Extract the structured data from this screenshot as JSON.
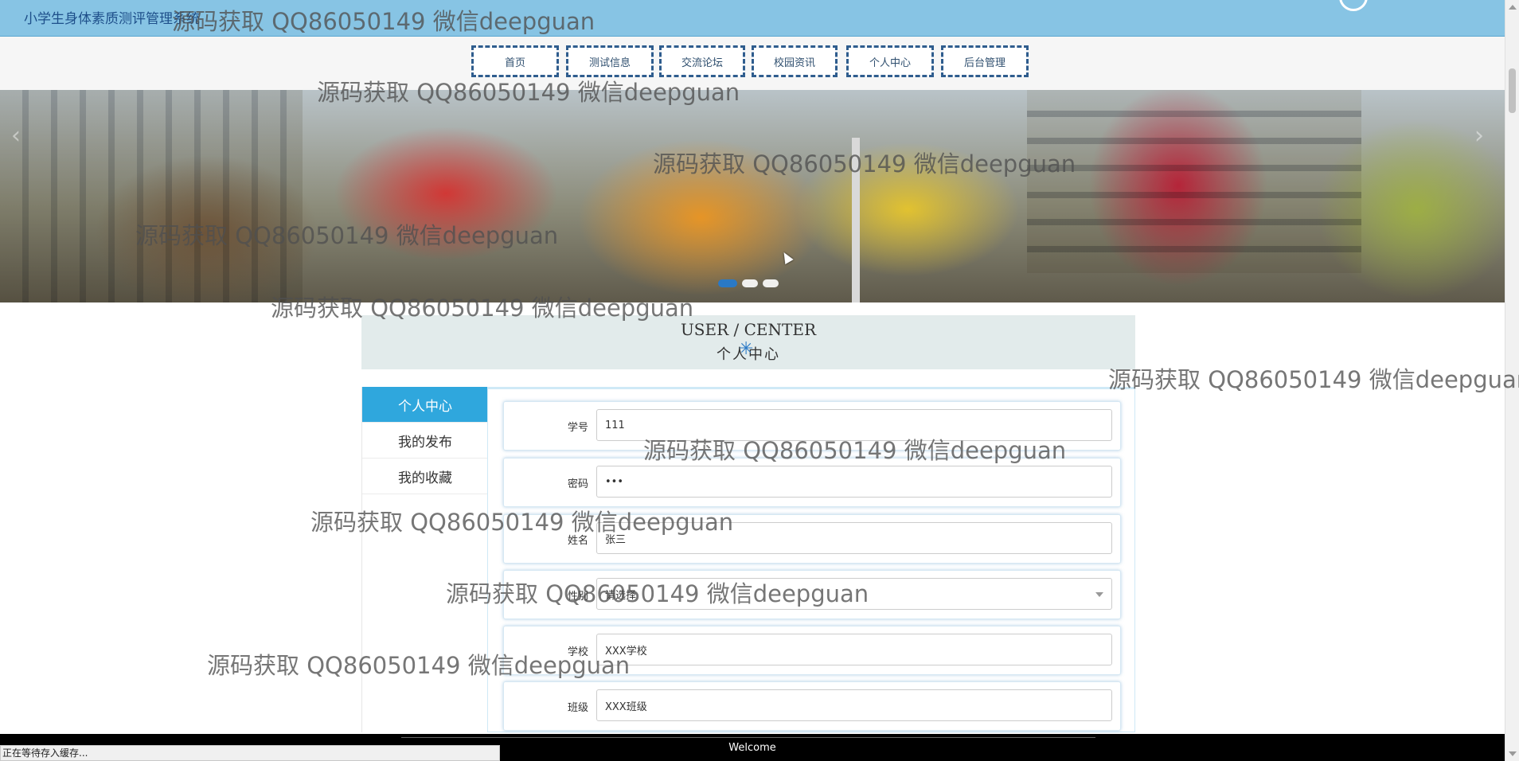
{
  "site_title": "小学生身体素质测评管理系统",
  "nav": [
    "首页",
    "测试信息",
    "交流论坛",
    "校园资讯",
    "个人中心",
    "后台管理"
  ],
  "banner": {
    "prev_glyph": "‹",
    "next_glyph": "›",
    "slide_count": 3,
    "active_slide": 1
  },
  "center_header": {
    "en": "USER / CENTER",
    "cn": "个人中心"
  },
  "sidebar": [
    "个人中心",
    "我的发布",
    "我的收藏"
  ],
  "form": {
    "student_id": {
      "label": "学号",
      "value": "111"
    },
    "password": {
      "label": "密码",
      "value": "•••"
    },
    "name": {
      "label": "姓名",
      "value": "张三"
    },
    "gender": {
      "label": "性别",
      "value": "请选择"
    },
    "school": {
      "label": "学校",
      "value": "XXX学校"
    },
    "class": {
      "label": "班级",
      "value": "XXX班级"
    }
  },
  "footer": {
    "text": "Welcome"
  },
  "status_bar": "正在等待存入缓存...",
  "watermark": "源码获取 QQ86050149 微信deepguan",
  "colors": {
    "topbar": "#87c4e4",
    "nav_border": "#2f5d8e",
    "sidebar_active": "#2fa7dd",
    "footer": "#000000"
  }
}
